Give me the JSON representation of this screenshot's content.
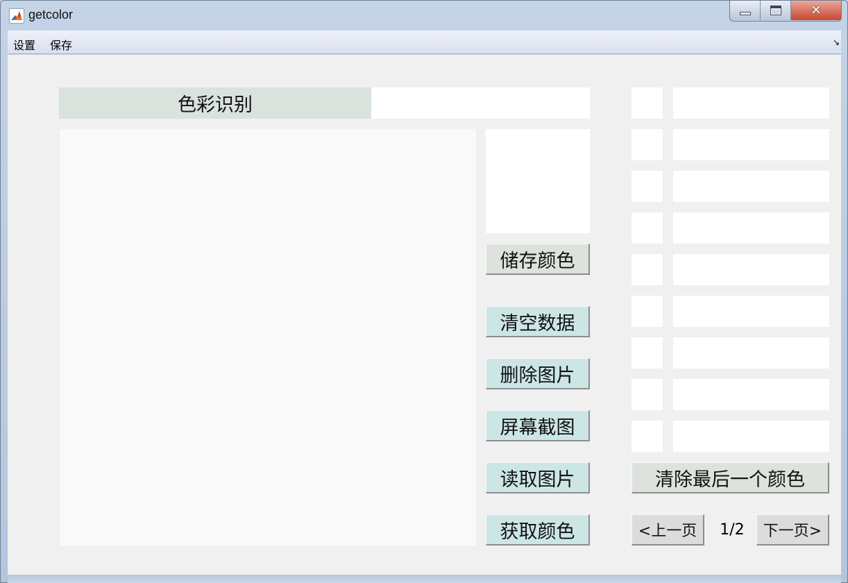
{
  "window": {
    "title": "getcolor",
    "icon": "matlab-icon",
    "controls": [
      "minimize-icon",
      "maximize-icon",
      "close-icon"
    ]
  },
  "menu": {
    "items": [
      "设置",
      "保存"
    ],
    "corner_glyph": "↘"
  },
  "panel": {
    "title": "色彩识别"
  },
  "buttons": {
    "save_color": "储存颜色",
    "clear_data": "清空数据",
    "delete_image": "删除图片",
    "screenshot": "屏幕截图",
    "read_image": "读取图片",
    "get_color": "获取颜色",
    "clear_last_color": "清除最后一个颜色",
    "prev_page": "<上一页",
    "next_page": "下一页>"
  },
  "pagination": {
    "current": "1/2"
  },
  "colors": {
    "title_bg": "#dae2dd",
    "button_green": "#dde2dd",
    "button_teal": "#cce6e6",
    "button_gray": "#dcdcdc",
    "client_bg": "#f0f0f0"
  }
}
